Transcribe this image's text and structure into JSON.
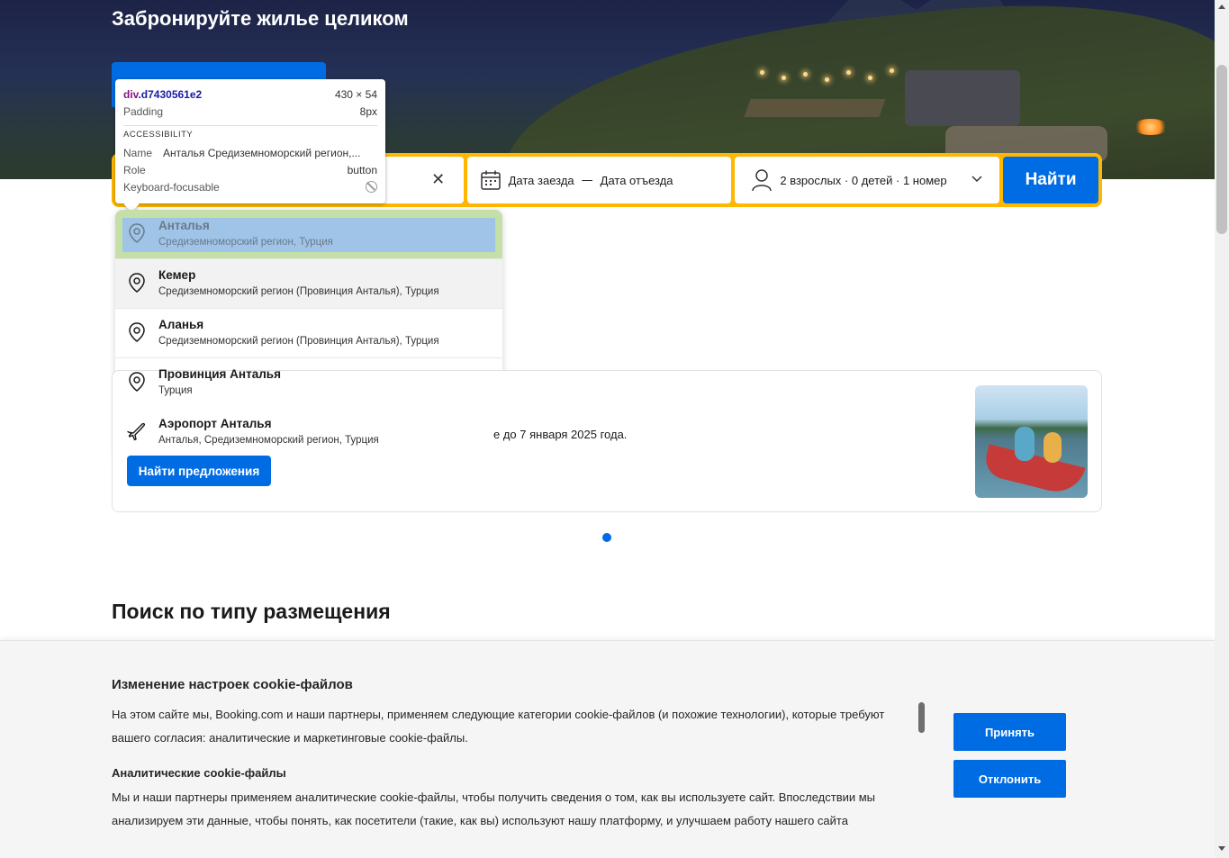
{
  "hero": {
    "title": "Забронируйте жилье целиком"
  },
  "search": {
    "dates": {
      "checkin_placeholder": "Дата заезда",
      "separator": "—",
      "checkout_placeholder": "Дата отъезда"
    },
    "guests_summary": "2 взрослых · 0 детей · 1 номер",
    "submit_label": "Найти",
    "icons": {
      "clear": "close-icon",
      "calendar": "calendar-icon",
      "person": "person-icon",
      "chevron": "chevron-down-icon"
    }
  },
  "devtools_tooltip": {
    "element_tag": "div",
    "element_class": ".d7430561e2",
    "size": "430 × 54",
    "padding_label": "Padding",
    "padding_value": "8px",
    "section_label": "ACCESSIBILITY",
    "name_label": "Name",
    "name_value": "Анталья Средиземноморский регион,...",
    "role_label": "Role",
    "role_value": "button",
    "focusable_label": "Keyboard-focusable"
  },
  "suggestions": [
    {
      "title": "Анталья",
      "subtitle": "Средиземноморский регион, Турция",
      "icon": "location-pin-icon"
    },
    {
      "title": "Кемер",
      "subtitle": "Средиземноморский регион (Провинция Анталья), Турция",
      "icon": "location-pin-icon"
    },
    {
      "title": "Аланья",
      "subtitle": "Средиземноморский регион (Провинция Анталья), Турция",
      "icon": "location-pin-icon"
    },
    {
      "title": "Провинция Анталья",
      "subtitle": "Турция",
      "icon": "location-pin-icon"
    },
    {
      "title": "Аэропорт Анталья",
      "subtitle": "Анталья, Средиземноморский регион, Турция",
      "icon": "airplane-icon"
    }
  ],
  "promo": {
    "text_visible": "е до 7 января 2025 года.",
    "button_label": "Найти предложения"
  },
  "section": {
    "title": "Поиск по типу размещения"
  },
  "cookie_banner": {
    "title": "Изменение настроек cookie-файлов",
    "intro": "На этом сайте мы, Booking.com и наши партнеры, применяем следующие категории cookie-файлов (и похожие технологии), которые требуют вашего согласия: аналитические и маркетинговые cookie-файлы.",
    "analytics_heading": "Аналитические cookie-файлы",
    "analytics_text": "Мы и наши партнеры применяем аналитические cookie-файлы, чтобы получить сведения о том, как вы используете сайт. Впоследствии мы анализируем эти данные, чтобы понять, как посетители (такие, как вы) используют нашу платформу, и улучшаем работу нашего сайта",
    "accept_label": "Принять",
    "reject_label": "Отклонить"
  },
  "colors": {
    "brand_blue": "#006ce4",
    "search_border": "#ffb700",
    "active_highlight": "#9fc4e8"
  }
}
